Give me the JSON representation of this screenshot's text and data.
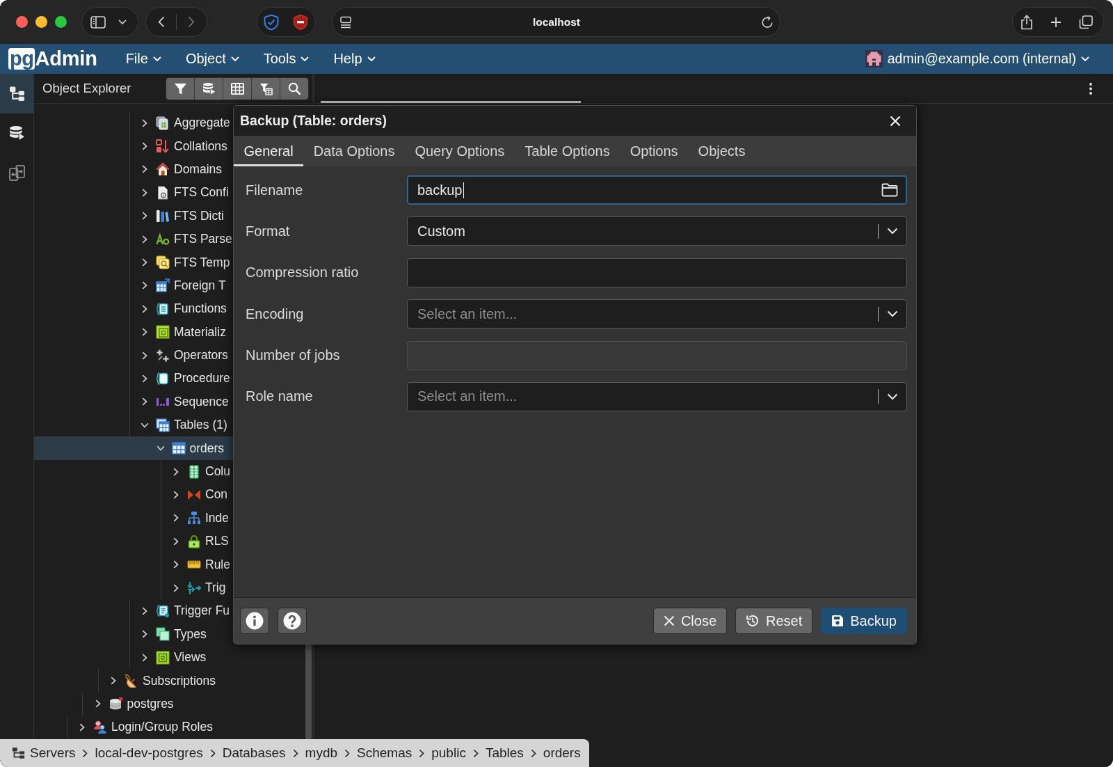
{
  "browser": {
    "address": "localhost"
  },
  "app": {
    "logo": {
      "badge": "pg",
      "name": "Admin"
    },
    "menu": [
      {
        "label": "File"
      },
      {
        "label": "Object"
      },
      {
        "label": "Tools"
      },
      {
        "label": "Help"
      }
    ],
    "user": "admin@example.com (internal)"
  },
  "activity_bar": [
    {
      "kind": "tree",
      "selected": true
    },
    {
      "kind": "database",
      "selected": false
    },
    {
      "kind": "compare",
      "selected": false
    }
  ],
  "explorer": {
    "title": "Object Explorer",
    "tree": [
      {
        "children": [
          {
            "children": [
              {
                "children": [
                  {
                    "children": [
                      {
                        "label": "Aggregate",
                        "kind": "aggregate",
                        "expanded": false,
                        "selected": false
                      },
                      {
                        "label": "Collations",
                        "kind": "collation",
                        "expanded": false,
                        "selected": false
                      },
                      {
                        "label": "Domains",
                        "kind": "domain",
                        "expanded": false,
                        "selected": false
                      },
                      {
                        "label": "FTS Confi",
                        "kind": "ftsconfig",
                        "expanded": false,
                        "selected": false
                      },
                      {
                        "label": "FTS Dicti",
                        "kind": "ftsdict",
                        "expanded": false,
                        "selected": false
                      },
                      {
                        "label": "FTS Parse",
                        "kind": "ftsparser",
                        "expanded": false,
                        "selected": false
                      },
                      {
                        "label": "FTS Temp",
                        "kind": "ftstemplate",
                        "expanded": false,
                        "selected": false
                      },
                      {
                        "label": "Foreign T",
                        "kind": "foreigntable",
                        "expanded": false,
                        "selected": false
                      },
                      {
                        "label": "Functions",
                        "kind": "function",
                        "expanded": false,
                        "selected": false
                      },
                      {
                        "label": "Materializ",
                        "kind": "matview",
                        "expanded": false,
                        "selected": false
                      },
                      {
                        "label": "Operators",
                        "kind": "operator",
                        "expanded": false,
                        "selected": false
                      },
                      {
                        "label": "Procedure",
                        "kind": "procedure",
                        "expanded": false,
                        "selected": false
                      },
                      {
                        "label": "Sequence",
                        "kind": "sequence",
                        "expanded": false,
                        "selected": false
                      },
                      {
                        "label": "Tables (1)",
                        "kind": "tables",
                        "expanded": true,
                        "selected": false,
                        "children": [
                          {
                            "label": "orders",
                            "kind": "table",
                            "expanded": true,
                            "selected": true,
                            "children": [
                              {
                                "label": "Colu",
                                "kind": "column",
                                "expanded": false,
                                "selected": false
                              },
                              {
                                "label": "Con",
                                "kind": "constraint",
                                "expanded": false,
                                "selected": false
                              },
                              {
                                "label": "Inde",
                                "kind": "index",
                                "expanded": false,
                                "selected": false
                              },
                              {
                                "label": "RLS",
                                "kind": "rls",
                                "expanded": false,
                                "selected": false
                              },
                              {
                                "label": "Rule",
                                "kind": "rule",
                                "expanded": false,
                                "selected": false
                              },
                              {
                                "label": "Trig",
                                "kind": "trigger",
                                "expanded": false,
                                "selected": false
                              }
                            ]
                          }
                        ]
                      },
                      {
                        "label": "Trigger Fu",
                        "kind": "triggerfunction",
                        "expanded": false,
                        "selected": false
                      },
                      {
                        "label": "Types",
                        "kind": "type",
                        "expanded": false,
                        "selected": false
                      },
                      {
                        "label": "Views",
                        "kind": "view",
                        "expanded": false,
                        "selected": false
                      }
                    ]
                  }
                ]
              },
              {
                "label": "Subscriptions",
                "kind": "subscription",
                "expanded": false,
                "selected": false
              }
            ]
          },
          {
            "label": "postgres",
            "kind": "database",
            "expanded": false,
            "selected": false
          }
        ]
      },
      {
        "label": "Login/Group Roles",
        "kind": "roles",
        "expanded": false,
        "selected": false
      }
    ]
  },
  "dialog": {
    "title": "Backup (Table: orders)",
    "tabs": [
      {
        "label": "General",
        "selected": true
      },
      {
        "label": "Data Options",
        "selected": false
      },
      {
        "label": "Query Options",
        "selected": false
      },
      {
        "label": "Table Options",
        "selected": false
      },
      {
        "label": "Options",
        "selected": false
      },
      {
        "label": "Objects",
        "selected": false
      }
    ],
    "fields": [
      {
        "label": "Filename",
        "kind": "file",
        "value": "backup",
        "focused": true,
        "disabled": false
      },
      {
        "label": "Format",
        "kind": "select",
        "value": "Custom",
        "focused": false,
        "disabled": false
      },
      {
        "label": "Compression ratio",
        "kind": "text",
        "focused": false,
        "disabled": false
      },
      {
        "label": "Encoding",
        "kind": "select",
        "placeholder": "Select an item...",
        "focused": false,
        "disabled": false
      },
      {
        "label": "Number of jobs",
        "kind": "text",
        "focused": false,
        "disabled": true
      },
      {
        "label": "Role name",
        "kind": "select",
        "placeholder": "Select an item...",
        "focused": false,
        "disabled": false
      }
    ],
    "buttons": [
      {
        "label": "Close",
        "kind": "close"
      },
      {
        "label": "Reset",
        "kind": "reset"
      },
      {
        "label": "Backup",
        "kind": "submit"
      }
    ]
  },
  "breadcrumb": [
    "Servers",
    "local-dev-postgres",
    "Databases",
    "mydb",
    "Schemas",
    "public",
    "Tables",
    "orders"
  ]
}
